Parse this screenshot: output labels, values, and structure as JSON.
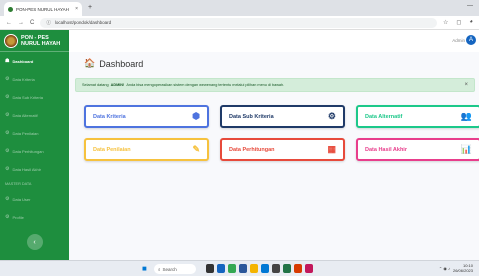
{
  "browser": {
    "tab_title": "PON-PES NURUL HAYAH",
    "tab_close": "×",
    "new_tab": "+",
    "window_controls": "—",
    "url": "localhost/pondok/dashboard",
    "nav_back": "←",
    "nav_forward": "→",
    "nav_reload": "C",
    "star": "☆",
    "ext": "◻",
    "profile": "◕"
  },
  "sidebar": {
    "brand_line1": "PON - PES",
    "brand_line2": "NURUL HAYAH",
    "items": [
      {
        "label": "Dashboard",
        "icon": "☗"
      },
      {
        "label": "Data Kriteria",
        "icon": "⚙"
      },
      {
        "label": "Data Sub Kriteria",
        "icon": "⚙"
      },
      {
        "label": "Data Alternatif",
        "icon": "⚙"
      },
      {
        "label": "Data Penilaian",
        "icon": "⚙"
      },
      {
        "label": "Data Perhitungan",
        "icon": "⚙"
      },
      {
        "label": "Data Hasil Akhir",
        "icon": "⚙"
      }
    ],
    "heading": "MASTER DATA",
    "items2": [
      {
        "label": "Data User",
        "icon": "⚙"
      },
      {
        "label": "Profile",
        "icon": "⚙"
      }
    ],
    "toggle": "‹"
  },
  "topbar": {
    "user_name": "Admin",
    "user_initial": "A"
  },
  "main": {
    "title": "Dashboard",
    "alert_pre": "Selamat datang",
    "alert_bold": "ADMIN!",
    "alert_post": "Anda bisa mengoperasikan sistem dengan wewenang tertentu melalui pilihan menu di bawah.",
    "alert_close": "×",
    "cards": [
      {
        "label": "Data Kriteria",
        "icon": "⬢"
      },
      {
        "label": "Data Sub Kriteria",
        "icon": "⚙"
      },
      {
        "label": "Data Alternatif",
        "icon": "👥"
      },
      {
        "label": "Data Penilaian",
        "icon": "✎"
      },
      {
        "label": "Data Perhitungan",
        "icon": "▦"
      },
      {
        "label": "Data Hasil Akhir",
        "icon": "📊"
      }
    ]
  },
  "taskbar": {
    "start": "■",
    "search_label": "Search",
    "time": "10:10",
    "date": "26/06/2023",
    "tray_icons": "⌃ ◉ ♪"
  },
  "colors": {
    "sidebar": "#1e8e3e",
    "blue": "#4e73df",
    "navy": "#1f3a68",
    "green": "#1cc88a",
    "yellow": "#f6c23e",
    "red": "#e74a3b",
    "pink": "#e83e8c"
  }
}
